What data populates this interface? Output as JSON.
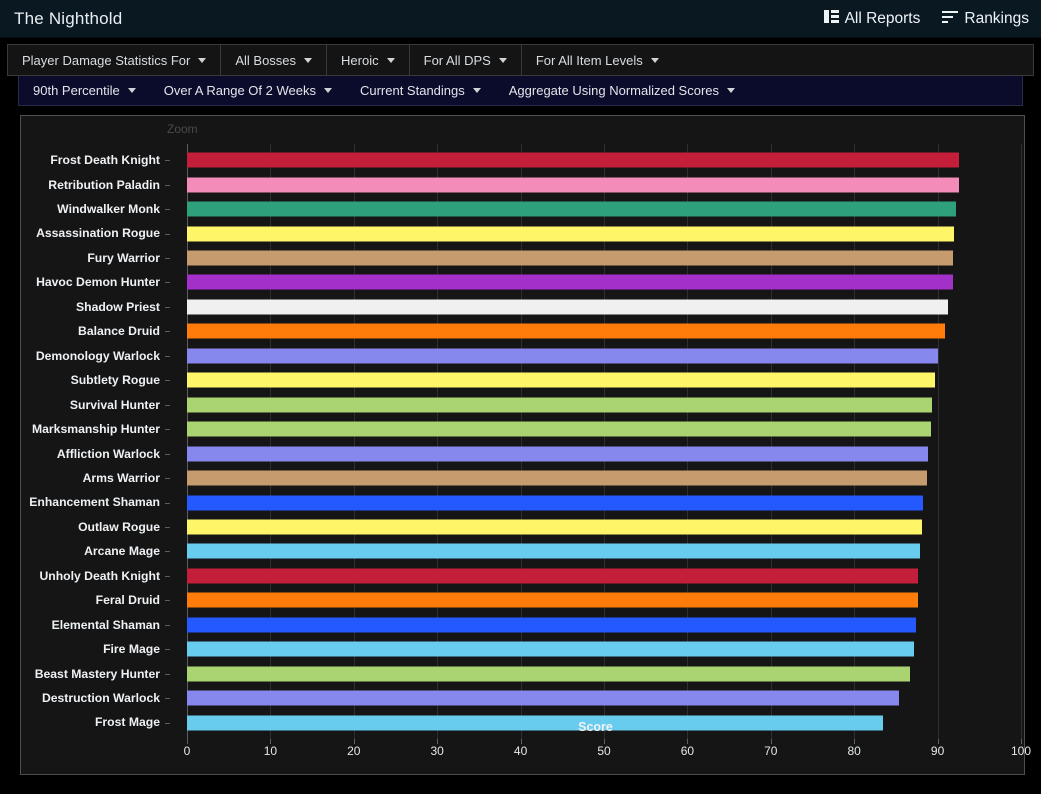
{
  "header": {
    "title": "The Nighthold",
    "links": [
      {
        "label": "All Reports",
        "icon": "table-list-icon"
      },
      {
        "label": "Rankings",
        "icon": "sort-bars-icon"
      }
    ]
  },
  "filters_row1": [
    {
      "label": "Player Damage Statistics For"
    },
    {
      "label": "All Bosses"
    },
    {
      "label": "Heroic"
    },
    {
      "label": "For All DPS"
    },
    {
      "label": "For All Item Levels"
    }
  ],
  "filters_row2": [
    {
      "label": "90th Percentile"
    },
    {
      "label": "Over A Range Of 2 Weeks"
    },
    {
      "label": "Current Standings"
    },
    {
      "label": "Aggregate Using Normalized Scores"
    }
  ],
  "chart_panel": {
    "zoom_label": "Zoom"
  },
  "chart_data": {
    "type": "bar",
    "orientation": "horizontal",
    "title": "",
    "xlabel": "Score",
    "ylabel": "",
    "xlim": [
      0,
      100
    ],
    "xticks": [
      0,
      10,
      20,
      30,
      40,
      50,
      60,
      70,
      80,
      90,
      100
    ],
    "grid": true,
    "legend": "none",
    "categories": [
      "Frost Death Knight",
      "Retribution Paladin",
      "Windwalker Monk",
      "Assassination Rogue",
      "Fury Warrior",
      "Havoc Demon Hunter",
      "Shadow Priest",
      "Balance Druid",
      "Demonology Warlock",
      "Subtlety Rogue",
      "Survival Hunter",
      "Marksmanship Hunter",
      "Affliction Warlock",
      "Arms Warrior",
      "Enhancement Shaman",
      "Outlaw Rogue",
      "Arcane Mage",
      "Unholy Death Knight",
      "Feral Druid",
      "Elemental Shaman",
      "Fire Mage",
      "Beast Mastery Hunter",
      "Destruction Warlock",
      "Frost Mage"
    ],
    "values": [
      92.6,
      92.6,
      92.2,
      92.0,
      91.9,
      91.8,
      91.2,
      90.9,
      90.1,
      89.7,
      89.3,
      89.2,
      88.9,
      88.7,
      88.3,
      88.1,
      87.9,
      87.7,
      87.6,
      87.4,
      87.2,
      86.7,
      85.4,
      83.4
    ],
    "colors": [
      "#C41E3A",
      "#F48CBA",
      "#2EA07B",
      "#FFF569",
      "#C69B6D",
      "#A330C9",
      "#F0F0F0",
      "#FF7C0A",
      "#8788EE",
      "#FFF569",
      "#AAD372",
      "#AAD372",
      "#8788EE",
      "#C69B6D",
      "#2459FF",
      "#FFF569",
      "#68CCEF",
      "#C41E3A",
      "#FF7C0A",
      "#2459FF",
      "#68CCEF",
      "#AAD372",
      "#8788EE",
      "#68CCEF"
    ]
  }
}
